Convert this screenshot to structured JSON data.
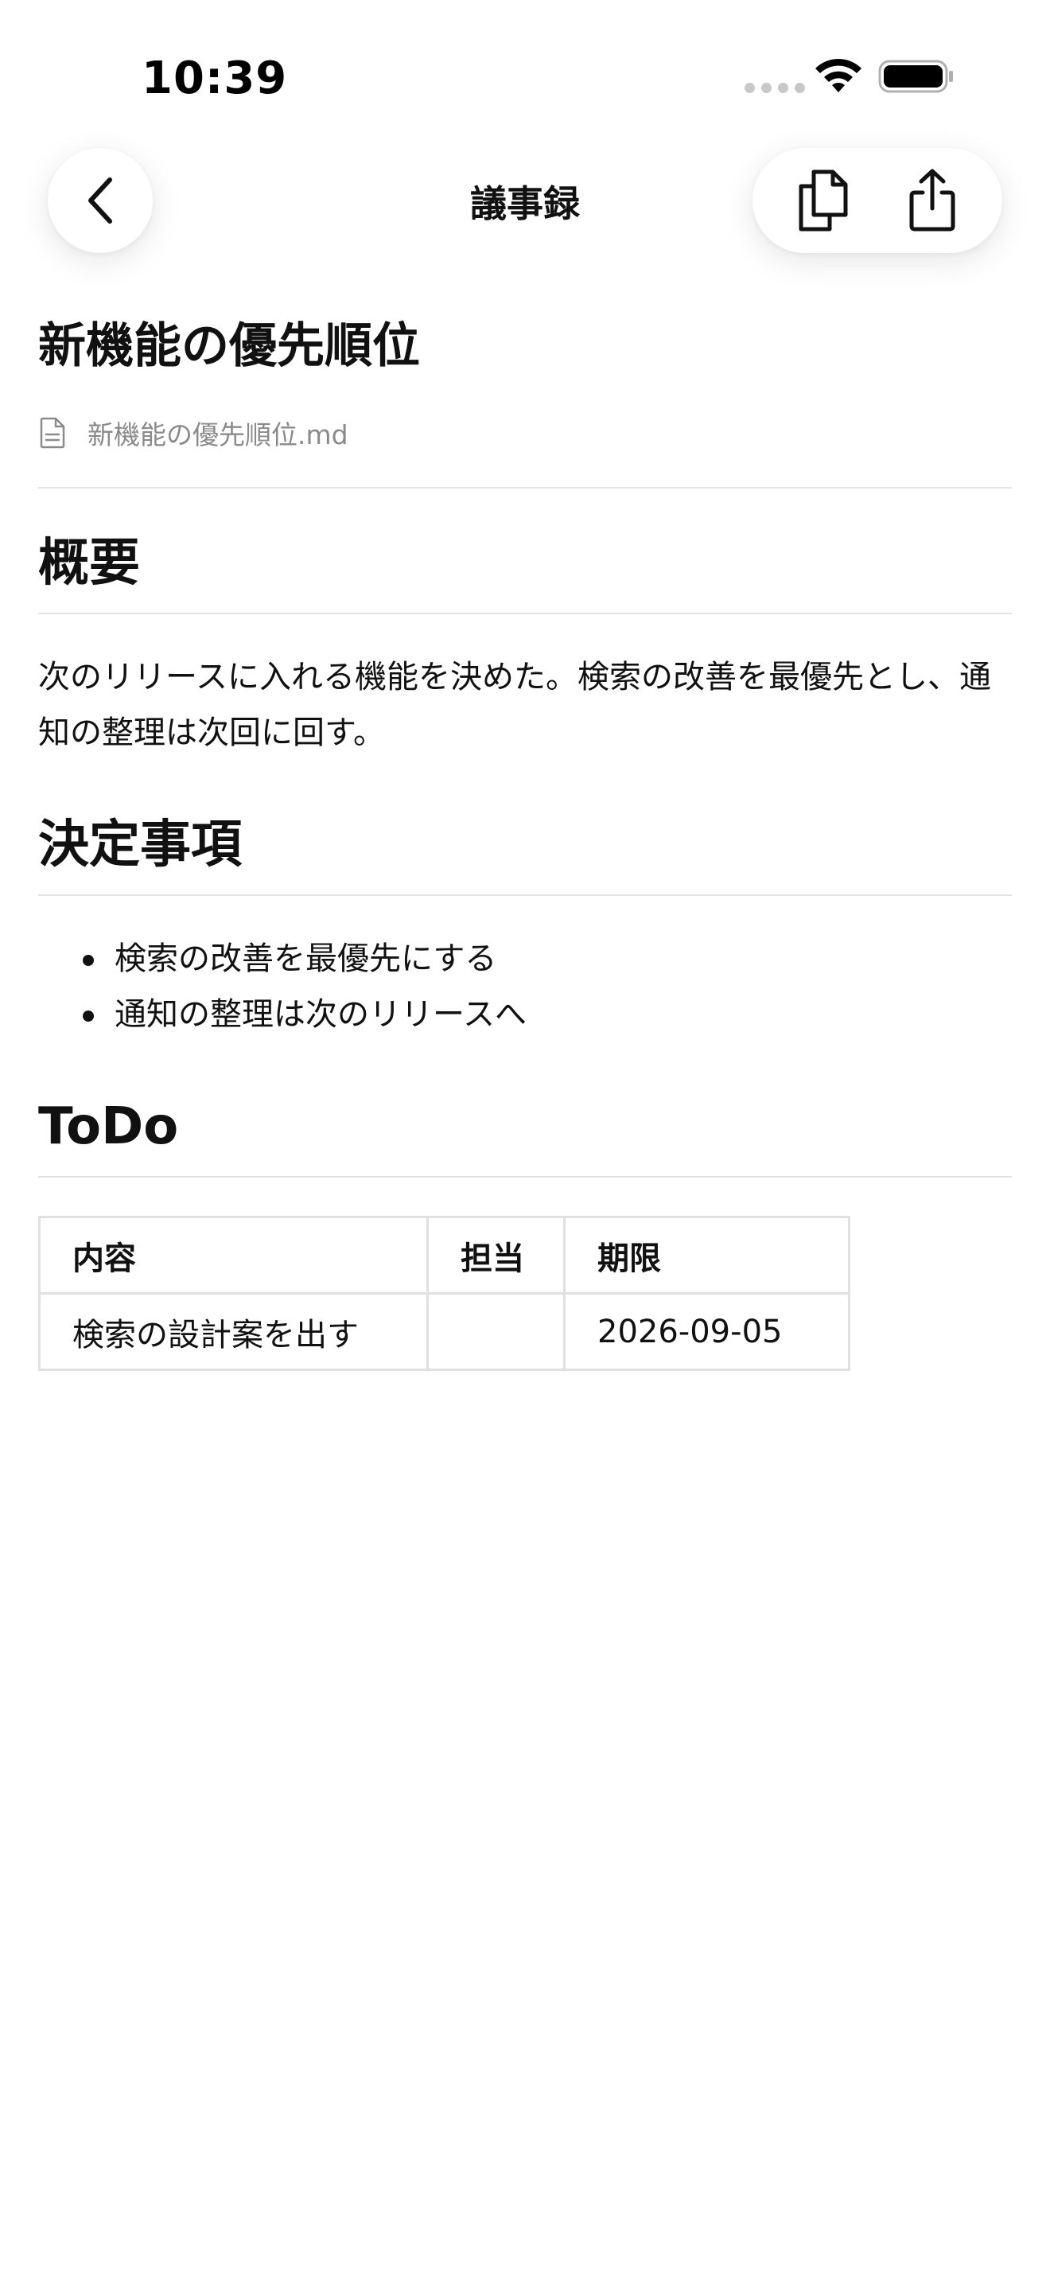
{
  "status_bar": {
    "time": "10:39",
    "icons": [
      "cellular-signal-icon",
      "wifi-icon",
      "battery-icon"
    ]
  },
  "nav": {
    "title": "議事録",
    "icons": [
      "back-chevron-icon",
      "copy-icon",
      "share-icon"
    ]
  },
  "document": {
    "title": "新機能の優先順位",
    "file_name": "新機能の優先順位.md",
    "file_icon": "document-icon",
    "sections": [
      {
        "heading": "概要",
        "paragraph": "次のリリースに入れる機能を決めた。検索の改善を最優先とし、通知の整理は次回に回す。"
      },
      {
        "heading": "決定事項",
        "bullets": [
          "検索の改善を最優先にする",
          "通知の整理は次のリリースへ"
        ]
      },
      {
        "heading": "ToDo",
        "table": {
          "headers": [
            "内容",
            "担当",
            "期限"
          ],
          "rows": [
            [
              "検索の設計案を出す",
              "",
              "2026-09-05"
            ]
          ]
        }
      }
    ]
  },
  "colors": {
    "text": "#111111",
    "muted": "#8a8a8a",
    "divider": "#e3e3e3",
    "background": "#ffffff"
  }
}
